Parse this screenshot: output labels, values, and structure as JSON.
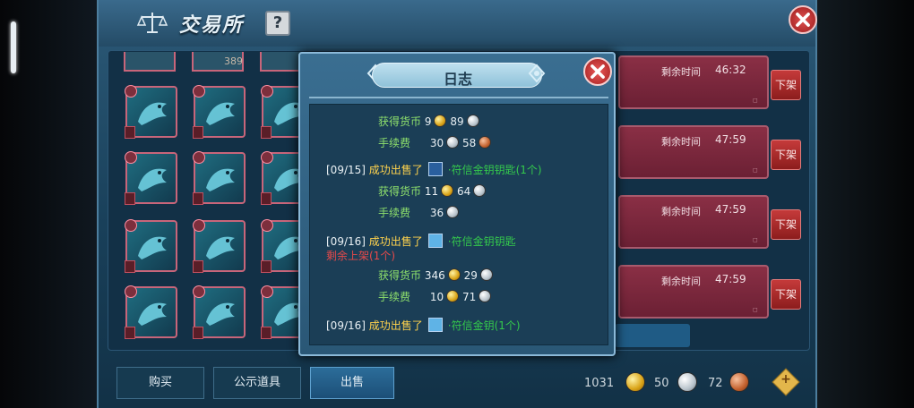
{
  "window": {
    "title": "交易所",
    "help_label": "?",
    "top_count": "389"
  },
  "listings": [
    {
      "time_label": "剩余时间",
      "time_value": "46:32",
      "unlist_label": "下架"
    },
    {
      "time_label": "剩余时间",
      "time_value": "47:59",
      "unlist_label": "下架"
    },
    {
      "time_label": "剩余时间",
      "time_value": "47:59",
      "unlist_label": "下架"
    },
    {
      "time_label": "剩余时间",
      "time_value": "47:59",
      "unlist_label": "下架"
    }
  ],
  "tabs": [
    {
      "label": "购买",
      "active": false
    },
    {
      "label": "公示道具",
      "active": false
    },
    {
      "label": "出售",
      "active": true
    }
  ],
  "currency": {
    "gold": "1031",
    "silver": "50",
    "copper": "72"
  },
  "log_dialog": {
    "title": "日志",
    "entries": [
      {
        "income_label": "获得货币",
        "income_gold": "9",
        "income_silver": "89",
        "fee_label": "手续费",
        "fee_silver": "30",
        "fee_copper": "58"
      },
      {
        "date": "[09/15]",
        "sold_label": "成功出售了",
        "item_name": "·符信金钥钥匙(1个)",
        "income_label": "获得货币",
        "income_gold": "11",
        "income_silver": "64",
        "fee_label": "手续费",
        "fee_silver": "36"
      },
      {
        "date": "[09/16]",
        "sold_label": "成功出售了",
        "item_name": "·符信金钥钥匙",
        "item_extra": "剩余上架(1个)",
        "income_label": "获得货币",
        "income_gold": "346",
        "income_silver": "29",
        "fee_label": "手续费",
        "fee_gold": "10",
        "fee_silver": "71"
      },
      {
        "date": "[09/16]",
        "sold_label": "成功出售了",
        "item_name": "·符信金钥(1个)"
      }
    ]
  }
}
